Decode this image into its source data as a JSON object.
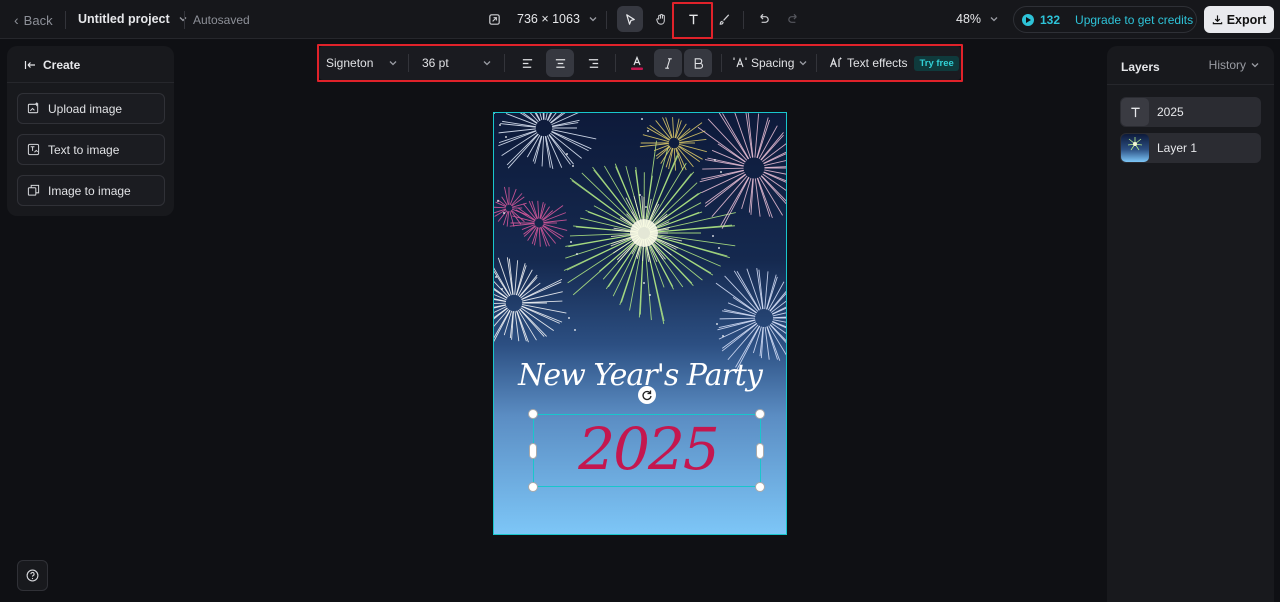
{
  "topbar": {
    "back_label": "Back",
    "project_title": "Untitled project",
    "save_status": "Autosaved",
    "canvas_size": "736 × 1063",
    "zoom": "48%",
    "credits_count": "132",
    "upgrade_label": "Upgrade to get credits",
    "export_label": "Export"
  },
  "left_panel": {
    "title": "Create",
    "buttons": [
      {
        "label": "Upload image",
        "icon": "upload-image-icon"
      },
      {
        "label": "Text to image",
        "icon": "text-to-image-icon"
      },
      {
        "label": "Image to image",
        "icon": "image-to-image-icon"
      }
    ]
  },
  "text_toolbar": {
    "font": "Signeton",
    "size": "36 pt",
    "spacing_label": "Spacing",
    "effects_label": "Text effects",
    "effects_badge": "Try free",
    "text_color": "#c4174f"
  },
  "canvas": {
    "heading": "New Year's Party",
    "selected_text": "2025",
    "selected_text_color": "#c4174f"
  },
  "right_panel": {
    "title": "Layers",
    "history_label": "History",
    "layers": [
      {
        "name": "2025",
        "icon": "text-layer-icon"
      },
      {
        "name": "Layer 1",
        "icon": "image-layer-thumbnail"
      }
    ]
  },
  "colors": {
    "accent": "#19c6cc",
    "highlight": "#e0222a",
    "credits": "#2ec3d8"
  }
}
